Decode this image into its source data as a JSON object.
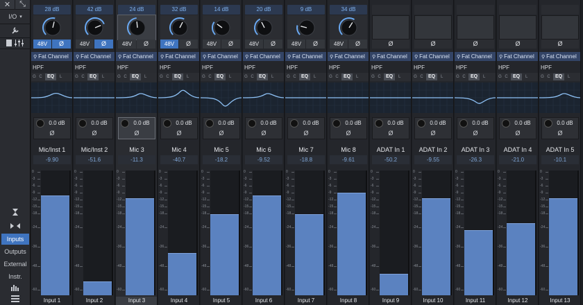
{
  "sidebar": {
    "close_glyph": "✕",
    "expand_glyph": "⤡",
    "io_label": "I/O",
    "io_caret": "▾",
    "wrench_glyph": "🔧",
    "collapse_glyph": "⧗",
    "arrows_glyph": "▸◂",
    "tabs": [
      {
        "label": "Inputs",
        "active": true
      },
      {
        "label": "Outputs",
        "active": false
      },
      {
        "label": "External",
        "active": false
      },
      {
        "label": "Instr.",
        "active": false
      }
    ]
  },
  "channels": [
    {
      "gain": "28 dB",
      "knob_fraction": 0.55,
      "phantom": "48V",
      "phantom_on": true,
      "phase": "Ø",
      "phase_on": true,
      "insert": "Fat Channel",
      "hpf": "HPF",
      "eq": "EQ",
      "eq_shape": "bump",
      "send": "0.0 dB",
      "send_phase": "Ø",
      "name": "Mic/Inst 1",
      "peak": "-9.90",
      "level": 0.8,
      "input": "Input 1",
      "selected": false,
      "empty": false
    },
    {
      "gain": "42 dB",
      "knob_fraction": 0.75,
      "phantom": "48V",
      "phantom_on": false,
      "phase": "Ø",
      "phase_on": true,
      "insert": "Fat Channel",
      "hpf": "HPF",
      "eq": "EQ",
      "eq_shape": "flat",
      "send": "0.0 dB",
      "send_phase": "Ø",
      "name": "Mic/Inst 2",
      "peak": "-51.6",
      "level": 0.11,
      "input": "Input 2",
      "selected": false,
      "empty": false
    },
    {
      "gain": "24 dB",
      "knob_fraction": 0.48,
      "phantom": "48V",
      "phantom_on": false,
      "phase": "Ø",
      "phase_on": false,
      "insert": "Fat Channel",
      "hpf": "HPF",
      "eq": "EQ",
      "eq_shape": "bump-small",
      "send": "0.0 dB",
      "send_phase": "Ø",
      "name": "Mic 3",
      "peak": "-11.3",
      "level": 0.78,
      "input": "Input 3",
      "selected": true,
      "empty": false
    },
    {
      "gain": "32 dB",
      "knob_fraction": 0.6,
      "phantom": "48V",
      "phantom_on": true,
      "phase": "Ø",
      "phase_on": false,
      "insert": "Fat Channel",
      "hpf": "HPF",
      "eq": "EQ",
      "eq_shape": "peak",
      "send": "0.0 dB",
      "send_phase": "Ø",
      "name": "Mic 4",
      "peak": "-40.7",
      "level": 0.34,
      "input": "Input 4",
      "selected": false,
      "empty": false
    },
    {
      "gain": "14 dB",
      "knob_fraction": 0.3,
      "phantom": "48V",
      "phantom_on": false,
      "phase": "Ø",
      "phase_on": false,
      "insert": "Fat Channel",
      "hpf": "HPF",
      "eq": "EQ",
      "eq_shape": "dip",
      "send": "0.0 dB",
      "send_phase": "Ø",
      "name": "Mic 5",
      "peak": "-18.2",
      "level": 0.65,
      "input": "Input 5",
      "selected": false,
      "empty": false
    },
    {
      "gain": "20 dB",
      "knob_fraction": 0.4,
      "phantom": "48V",
      "phantom_on": false,
      "phase": "Ø",
      "phase_on": false,
      "insert": "Fat Channel",
      "hpf": "HPF",
      "eq": "EQ",
      "eq_shape": "bump-small",
      "send": "0.0 dB",
      "send_phase": "Ø",
      "name": "Mic 6",
      "peak": "-9.52",
      "level": 0.8,
      "input": "Input 6",
      "selected": false,
      "empty": false
    },
    {
      "gain": "9 dB",
      "knob_fraction": 0.22,
      "phantom": "48V",
      "phantom_on": false,
      "phase": "Ø",
      "phase_on": false,
      "insert": "Fat Channel",
      "hpf": "HPF",
      "eq": "EQ",
      "eq_shape": "flat",
      "send": "0.0 dB",
      "send_phase": "Ø",
      "name": "Mic 7",
      "peak": "-18.8",
      "level": 0.65,
      "input": "Input 7",
      "selected": false,
      "empty": false
    },
    {
      "gain": "34 dB",
      "knob_fraction": 0.62,
      "phantom": "48V",
      "phantom_on": false,
      "phase": "Ø",
      "phase_on": false,
      "insert": "Fat Channel",
      "hpf": "HPF",
      "eq": "EQ",
      "eq_shape": "flat",
      "send": "0.0 dB",
      "send_phase": "Ø",
      "name": "Mic 8",
      "peak": "-9.61",
      "level": 0.82,
      "input": "Input 8",
      "selected": false,
      "empty": false
    },
    {
      "gain": "",
      "knob_fraction": 0,
      "phantom": "",
      "phantom_on": false,
      "phase": "Ø",
      "phase_on": false,
      "insert": "Fat Channel",
      "hpf": "HPF",
      "eq": "EQ",
      "eq_shape": "flat",
      "send": "0.0 dB",
      "send_phase": "Ø",
      "name": "ADAT In 1",
      "peak": "-50.2",
      "level": 0.17,
      "input": "Input 9",
      "selected": false,
      "empty": true
    },
    {
      "gain": "",
      "knob_fraction": 0,
      "phantom": "",
      "phantom_on": false,
      "phase": "Ø",
      "phase_on": false,
      "insert": "Fat Channel",
      "hpf": "HPF",
      "eq": "EQ",
      "eq_shape": "flat",
      "send": "0.0 dB",
      "send_phase": "Ø",
      "name": "ADAT In 2",
      "peak": "-9.55",
      "level": 0.78,
      "input": "Input 10",
      "selected": false,
      "empty": true
    },
    {
      "gain": "",
      "knob_fraction": 0,
      "phantom": "",
      "phantom_on": false,
      "phase": "Ø",
      "phase_on": false,
      "insert": "Fat Channel",
      "hpf": "HPF",
      "eq": "EQ",
      "eq_shape": "dip-small",
      "send": "0.0 dB",
      "send_phase": "Ø",
      "name": "ADAT In 3",
      "peak": "-26.3",
      "level": 0.52,
      "input": "Input 11",
      "selected": false,
      "empty": true
    },
    {
      "gain": "",
      "knob_fraction": 0,
      "phantom": "",
      "phantom_on": false,
      "phase": "Ø",
      "phase_on": false,
      "insert": "Fat Channel",
      "hpf": "HPF",
      "eq": "EQ",
      "eq_shape": "flat",
      "send": "0.0 dB",
      "send_phase": "Ø",
      "name": "ADAT In 4",
      "peak": "-21.0",
      "level": 0.58,
      "input": "Input 12",
      "selected": false,
      "empty": true
    },
    {
      "gain": "",
      "knob_fraction": 0,
      "phantom": "",
      "phantom_on": false,
      "phase": "Ø",
      "phase_on": false,
      "insert": "Fat Channel",
      "hpf": "HPF",
      "eq": "EQ",
      "eq_shape": "bump-small",
      "send": "0.0 dB",
      "send_phase": "Ø",
      "name": "ADAT In 5",
      "peak": "-10.1",
      "level": 0.78,
      "input": "Input 13",
      "selected": false,
      "empty": true
    }
  ],
  "meter_scale": [
    "0",
    "-3",
    "-6",
    "-9",
    "-12",
    "-15",
    "-18",
    "-24",
    "-36",
    "-48",
    "-60"
  ],
  "processing_slots": [
    "G",
    "C",
    "EQ",
    "L"
  ],
  "colors": {
    "accent": "#3f74bf",
    "meter": "#5b82c0",
    "gain_text": "#7fb1ee",
    "insert_bg": "#334466"
  }
}
